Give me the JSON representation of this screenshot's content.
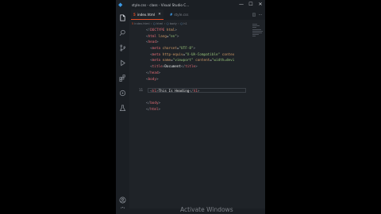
{
  "titlebar": {
    "title": "style.css - class - Visual Studio C...",
    "minimize": "—",
    "maximize": "☐",
    "close": "✕"
  },
  "activity_icons": [
    "explorer-icon",
    "search-icon",
    "source-control-icon",
    "run-debug-icon",
    "extensions-icon",
    "remote-icon",
    "testing-icon",
    "account-icon",
    "settings-icon"
  ],
  "tabs": [
    {
      "label": "index.html",
      "icon": "5",
      "close": "✕",
      "active": true
    },
    {
      "label": "style.css",
      "icon": "#",
      "active": false
    }
  ],
  "breadcrumb": [
    "index.html",
    "html",
    "body",
    "h1"
  ],
  "code_lines": [
    [
      {
        "c": "p",
        "t": "<!"
      },
      {
        "c": "t",
        "t": "DOCTYPE"
      },
      {
        "c": "a",
        "t": " html"
      },
      {
        "c": "p",
        "t": ">"
      }
    ],
    [
      {
        "c": "p",
        "t": "<"
      },
      {
        "c": "t",
        "t": "html"
      },
      {
        "c": "a",
        "t": " lang"
      },
      {
        "c": "x",
        "t": "="
      },
      {
        "c": "s",
        "t": "\"en\""
      },
      {
        "c": "p",
        "t": ">"
      }
    ],
    [
      {
        "c": "p",
        "t": "<"
      },
      {
        "c": "t",
        "t": "head"
      },
      {
        "c": "p",
        "t": ">"
      }
    ],
    [
      {
        "c": "x",
        "t": "  "
      },
      {
        "c": "p",
        "t": "<"
      },
      {
        "c": "t",
        "t": "meta"
      },
      {
        "c": "a",
        "t": " charset"
      },
      {
        "c": "x",
        "t": "="
      },
      {
        "c": "s",
        "t": "\"UTF-8\""
      },
      {
        "c": "p",
        "t": ">"
      }
    ],
    [
      {
        "c": "x",
        "t": "  "
      },
      {
        "c": "p",
        "t": "<"
      },
      {
        "c": "t",
        "t": "meta"
      },
      {
        "c": "a",
        "t": " http-equiv"
      },
      {
        "c": "x",
        "t": "="
      },
      {
        "c": "s",
        "t": "\"X-UA-Compatible\""
      },
      {
        "c": "a",
        "t": " contex"
      }
    ],
    [
      {
        "c": "x",
        "t": "  "
      },
      {
        "c": "p",
        "t": "<"
      },
      {
        "c": "t",
        "t": "meta"
      },
      {
        "c": "a",
        "t": " name"
      },
      {
        "c": "x",
        "t": "="
      },
      {
        "c": "s",
        "t": "\"viewport\""
      },
      {
        "c": "a",
        "t": " content"
      },
      {
        "c": "x",
        "t": "="
      },
      {
        "c": "s",
        "t": "\"width=devi"
      }
    ],
    [
      {
        "c": "x",
        "t": "  "
      },
      {
        "c": "p",
        "t": "<"
      },
      {
        "c": "t",
        "t": "title"
      },
      {
        "c": "p",
        "t": ">"
      },
      {
        "c": "x",
        "t": "Document"
      },
      {
        "c": "p",
        "t": "</"
      },
      {
        "c": "t",
        "t": "title"
      },
      {
        "c": "p",
        "t": ">"
      }
    ],
    [
      {
        "c": "p",
        "t": "</"
      },
      {
        "c": "t",
        "t": "head"
      },
      {
        "c": "p",
        "t": ">"
      }
    ],
    [
      {
        "c": "p",
        "t": "<"
      },
      {
        "c": "t",
        "t": "body"
      },
      {
        "c": "p",
        "t": ">"
      }
    ],
    [],
    [
      {
        "c": "x",
        "t": "  "
      },
      {
        "c": "p",
        "t": "<"
      },
      {
        "c": "t",
        "t": "h1"
      },
      {
        "c": "p",
        "t": ">"
      },
      {
        "c": "x",
        "t": "This Is Heading"
      },
      {
        "c": "p",
        "t": "</"
      },
      {
        "c": "t",
        "t": "h1"
      },
      {
        "c": "p",
        "t": ">"
      }
    ],
    [],
    [
      {
        "c": "p",
        "t": "</"
      },
      {
        "c": "t",
        "t": "body"
      },
      {
        "c": "p",
        "t": ">"
      }
    ],
    [
      {
        "c": "p",
        "t": "</"
      },
      {
        "c": "t",
        "t": "html"
      },
      {
        "c": "p",
        "t": ">"
      }
    ]
  ],
  "current_line_number": "11",
  "watermark": "Activate Windows"
}
